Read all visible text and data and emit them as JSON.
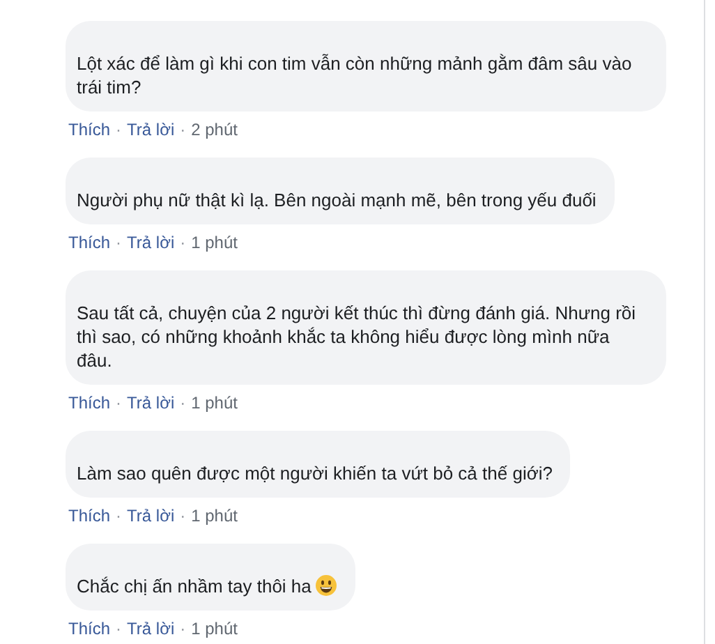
{
  "comments": [
    {
      "text": "Lột xác để làm gì khi con tim vẫn còn những mảnh gằm đâm sâu vào trái tim?",
      "like": "Thích",
      "sep1": "·",
      "reply": "Trả lời",
      "sep2": "·",
      "time": "2 phút",
      "emoji": false
    },
    {
      "text": "Người phụ nữ thật kì lạ. Bên ngoài mạnh mẽ, bên trong yếu đuối",
      "like": "Thích",
      "sep1": "·",
      "reply": "Trả lời",
      "sep2": "·",
      "time": "1 phút",
      "emoji": false
    },
    {
      "text": "Sau tất cả, chuyện của 2 người kết thúc thì đừng đánh giá. Nhưng rồi thì sao, có những khoảnh khắc ta không hiểu được lòng mình nữa đâu.",
      "like": "Thích",
      "sep1": "·",
      "reply": "Trả lời",
      "sep2": "·",
      "time": "1 phút",
      "emoji": false
    },
    {
      "text": "Làm sao quên được một người khiến ta vứt bỏ cả thế giới?",
      "like": "Thích",
      "sep1": "·",
      "reply": "Trả lời",
      "sep2": "·",
      "time": "1 phút",
      "emoji": false
    },
    {
      "text": "Chắc chị ấn nhầm tay thôi ha",
      "like": "Thích",
      "sep1": "·",
      "reply": "Trả lời",
      "sep2": "·",
      "time": "1 phút",
      "emoji": true
    }
  ]
}
